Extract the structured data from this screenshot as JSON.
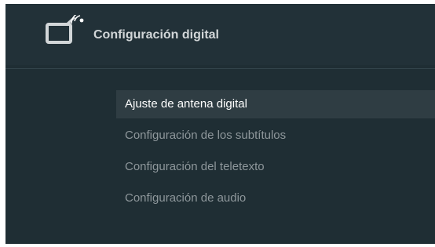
{
  "header": {
    "title": "Configuración digital",
    "icon": "tv-signal-icon"
  },
  "menu": {
    "items": [
      {
        "label": "Ajuste de antena digital",
        "selected": true
      },
      {
        "label": "Configuración de los subtítulos",
        "selected": false
      },
      {
        "label": "Configuración del teletexto",
        "selected": false
      },
      {
        "label": "Configuración de audio",
        "selected": false
      }
    ]
  },
  "colors": {
    "background": "#1f2e34",
    "selected_row": "#2f3d43",
    "selected_text": "#ffffff",
    "unselected_text": "#8e979b"
  }
}
